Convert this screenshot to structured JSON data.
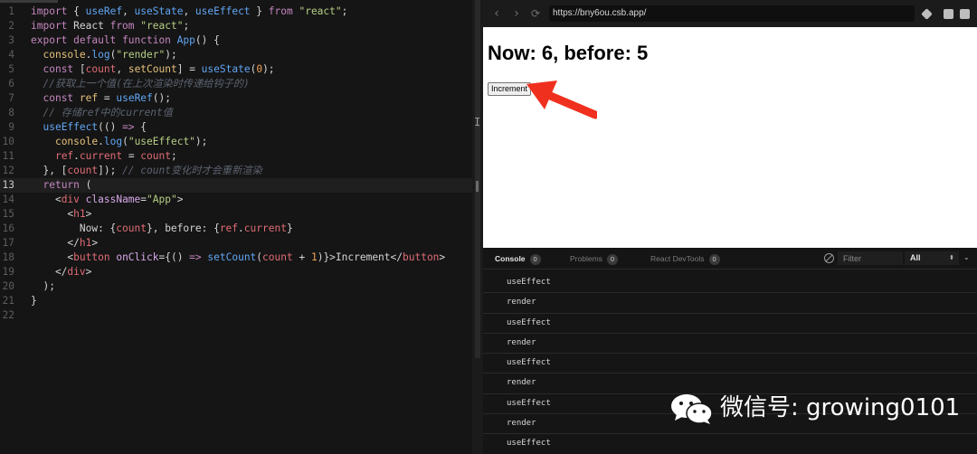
{
  "editor": {
    "active_line": 13,
    "lines": [
      {
        "n": "1",
        "tokens": [
          [
            "kw",
            "import"
          ],
          [
            "ident",
            " { "
          ],
          [
            "fn",
            "useRef"
          ],
          [
            "ident",
            ", "
          ],
          [
            "fn",
            "useState"
          ],
          [
            "ident",
            ", "
          ],
          [
            "fn",
            "useEffect"
          ],
          [
            "ident",
            " } "
          ],
          [
            "kw",
            "from"
          ],
          [
            "ident",
            " "
          ],
          [
            "str",
            "\"react\""
          ],
          [
            "ident",
            ";"
          ]
        ]
      },
      {
        "n": "2",
        "tokens": [
          [
            "kw",
            "import"
          ],
          [
            "ident",
            " React "
          ],
          [
            "kw",
            "from"
          ],
          [
            "ident",
            " "
          ],
          [
            "str",
            "\"react\""
          ],
          [
            "ident",
            ";"
          ]
        ]
      },
      {
        "n": "3",
        "tokens": [
          [
            "kw",
            "export default function"
          ],
          [
            "ident",
            " "
          ],
          [
            "fn",
            "App"
          ],
          [
            "ident",
            "() {"
          ]
        ]
      },
      {
        "n": "4",
        "tokens": [
          [
            "ident",
            "  "
          ],
          [
            "var",
            "console"
          ],
          [
            "ident",
            "."
          ],
          [
            "fn",
            "log"
          ],
          [
            "ident",
            "("
          ],
          [
            "str",
            "\"render\""
          ],
          [
            "ident",
            ");"
          ]
        ]
      },
      {
        "n": "5",
        "tokens": [
          [
            "ident",
            "  "
          ],
          [
            "kw",
            "const"
          ],
          [
            "ident",
            " ["
          ],
          [
            "tag",
            "count"
          ],
          [
            "ident",
            ", "
          ],
          [
            "var",
            "setCount"
          ],
          [
            "ident",
            "] = "
          ],
          [
            "fn",
            "useState"
          ],
          [
            "ident",
            "("
          ],
          [
            "num",
            "0"
          ],
          [
            "ident",
            ");"
          ]
        ]
      },
      {
        "n": "6",
        "tokens": [
          [
            "cm",
            "  //获取上一个值(在上次渲染时传递给钩子的)"
          ]
        ]
      },
      {
        "n": "7",
        "tokens": [
          [
            "ident",
            "  "
          ],
          [
            "kw",
            "const"
          ],
          [
            "ident",
            " "
          ],
          [
            "var",
            "ref"
          ],
          [
            "ident",
            " = "
          ],
          [
            "fn",
            "useRef"
          ],
          [
            "ident",
            "();"
          ]
        ]
      },
      {
        "n": "8",
        "tokens": [
          [
            "cm",
            "  // 存储ref中的current值"
          ]
        ]
      },
      {
        "n": "9",
        "tokens": [
          [
            "ident",
            "  "
          ],
          [
            "fn",
            "useEffect"
          ],
          [
            "ident",
            "(() "
          ],
          [
            "kw",
            "=>"
          ],
          [
            "ident",
            " {"
          ]
        ]
      },
      {
        "n": "10",
        "tokens": [
          [
            "ident",
            "    "
          ],
          [
            "var",
            "console"
          ],
          [
            "ident",
            "."
          ],
          [
            "fn",
            "log"
          ],
          [
            "ident",
            "("
          ],
          [
            "str",
            "\"useEffect\""
          ],
          [
            "ident",
            ");"
          ]
        ]
      },
      {
        "n": "11",
        "tokens": [
          [
            "ident",
            "    "
          ],
          [
            "tag",
            "ref"
          ],
          [
            "ident",
            "."
          ],
          [
            "tag",
            "current"
          ],
          [
            "ident",
            " = "
          ],
          [
            "tag",
            "count"
          ],
          [
            "ident",
            ";"
          ]
        ]
      },
      {
        "n": "12",
        "tokens": [
          [
            "ident",
            "  }, ["
          ],
          [
            "tag",
            "count"
          ],
          [
            "ident",
            "]); "
          ],
          [
            "cm",
            "// count变化时才会重新渲染"
          ]
        ]
      },
      {
        "n": "13",
        "tokens": [
          [
            "ident",
            "  "
          ],
          [
            "kw",
            "return"
          ],
          [
            "ident",
            " ("
          ]
        ]
      },
      {
        "n": "14",
        "tokens": [
          [
            "ident",
            "    <"
          ],
          [
            "tag",
            "div"
          ],
          [
            "ident",
            " "
          ],
          [
            "attr",
            "className"
          ],
          [
            "ident",
            "="
          ],
          [
            "str",
            "\"App\""
          ],
          [
            "ident",
            ">"
          ]
        ]
      },
      {
        "n": "15",
        "tokens": [
          [
            "ident",
            "      <"
          ],
          [
            "tag",
            "h1"
          ],
          [
            "ident",
            ">"
          ]
        ]
      },
      {
        "n": "16",
        "tokens": [
          [
            "ident",
            "        Now: {"
          ],
          [
            "tag",
            "count"
          ],
          [
            "ident",
            "}, before: {"
          ],
          [
            "tag",
            "ref"
          ],
          [
            "ident",
            "."
          ],
          [
            "tag",
            "current"
          ],
          [
            "ident",
            "}"
          ]
        ]
      },
      {
        "n": "17",
        "tokens": [
          [
            "ident",
            "      </"
          ],
          [
            "tag",
            "h1"
          ],
          [
            "ident",
            ">"
          ]
        ]
      },
      {
        "n": "18",
        "tokens": [
          [
            "ident",
            "      <"
          ],
          [
            "tag",
            "button"
          ],
          [
            "ident",
            " "
          ],
          [
            "attr",
            "onClick"
          ],
          [
            "ident",
            "={() "
          ],
          [
            "kw",
            "=>"
          ],
          [
            "ident",
            " "
          ],
          [
            "fn",
            "setCount"
          ],
          [
            "ident",
            "("
          ],
          [
            "tag",
            "count"
          ],
          [
            "ident",
            " + "
          ],
          [
            "num",
            "1"
          ],
          [
            "ident",
            ")}>Increment</"
          ],
          [
            "tag",
            "button"
          ],
          [
            "ident",
            ">"
          ]
        ]
      },
      {
        "n": "19",
        "tokens": [
          [
            "ident",
            "    </"
          ],
          [
            "tag",
            "div"
          ],
          [
            "ident",
            ">"
          ]
        ]
      },
      {
        "n": "20",
        "tokens": [
          [
            "ident",
            "  );"
          ]
        ]
      },
      {
        "n": "21",
        "tokens": [
          [
            "ident",
            "}"
          ]
        ]
      },
      {
        "n": "22",
        "tokens": []
      }
    ]
  },
  "browser": {
    "url": "https://bny6ou.csb.app/",
    "back_icon": "chevron-left-icon",
    "forward_icon": "chevron-right-icon",
    "reload_icon": "reload-icon",
    "preview": {
      "heading": "Now: 6, before: 5",
      "button_label": "Increment"
    },
    "annotation_color": "#f0301e"
  },
  "devtools": {
    "tabs": [
      {
        "label": "Console",
        "count": "0",
        "active": true
      },
      {
        "label": "Problems",
        "count": "0",
        "active": false
      },
      {
        "label": "React DevTools",
        "count": "0",
        "active": false
      }
    ],
    "filter_placeholder": "Filter",
    "level": "All",
    "logs": [
      "useEffect",
      "render",
      "useEffect",
      "render",
      "useEffect",
      "render",
      "useEffect",
      "render",
      "useEffect"
    ]
  },
  "watermark": {
    "text": "微信号: growing0101",
    "logo": "wechat-logo"
  }
}
